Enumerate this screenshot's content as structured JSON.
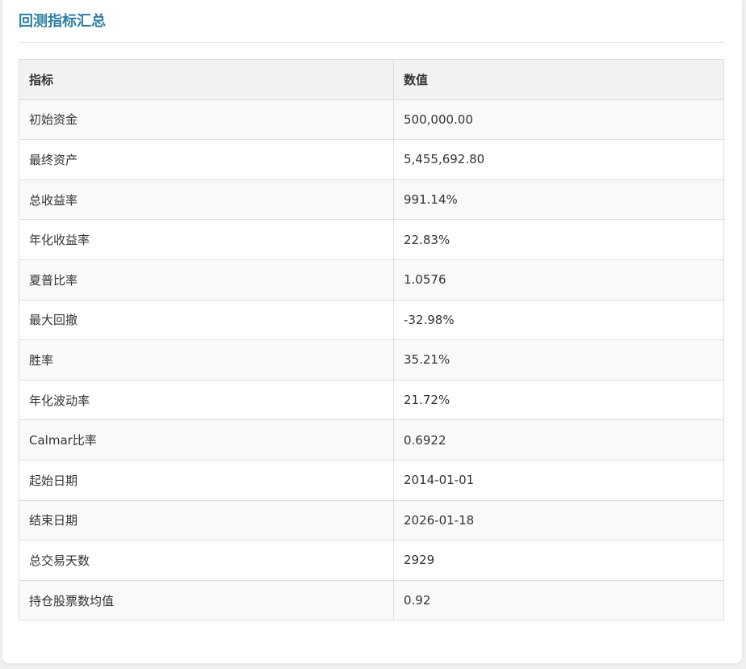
{
  "title": "回测指标汇总",
  "table": {
    "headers": [
      "指标",
      "数值"
    ],
    "rows": [
      {
        "name": "初始资金",
        "value": "500,000.00"
      },
      {
        "name": "最终资产",
        "value": "5,455,692.80"
      },
      {
        "name": "总收益率",
        "value": "991.14%"
      },
      {
        "name": "年化收益率",
        "value": "22.83%"
      },
      {
        "name": "夏普比率",
        "value": "1.0576"
      },
      {
        "name": "最大回撤",
        "value": "-32.98%"
      },
      {
        "name": "胜率",
        "value": "35.21%"
      },
      {
        "name": "年化波动率",
        "value": "21.72%"
      },
      {
        "name": "Calmar比率",
        "value": "0.6922"
      },
      {
        "name": "起始日期",
        "value": "2014-01-01"
      },
      {
        "name": "结束日期",
        "value": "2026-01-18"
      },
      {
        "name": "总交易天数",
        "value": "2929"
      },
      {
        "name": "持仓股票数均值",
        "value": "0.92"
      }
    ]
  },
  "colors": {
    "title": "#2f7fa1",
    "header_bg": "#f2f2f2",
    "row_odd_bg": "#f9f9f9",
    "border": "#dddddd"
  }
}
